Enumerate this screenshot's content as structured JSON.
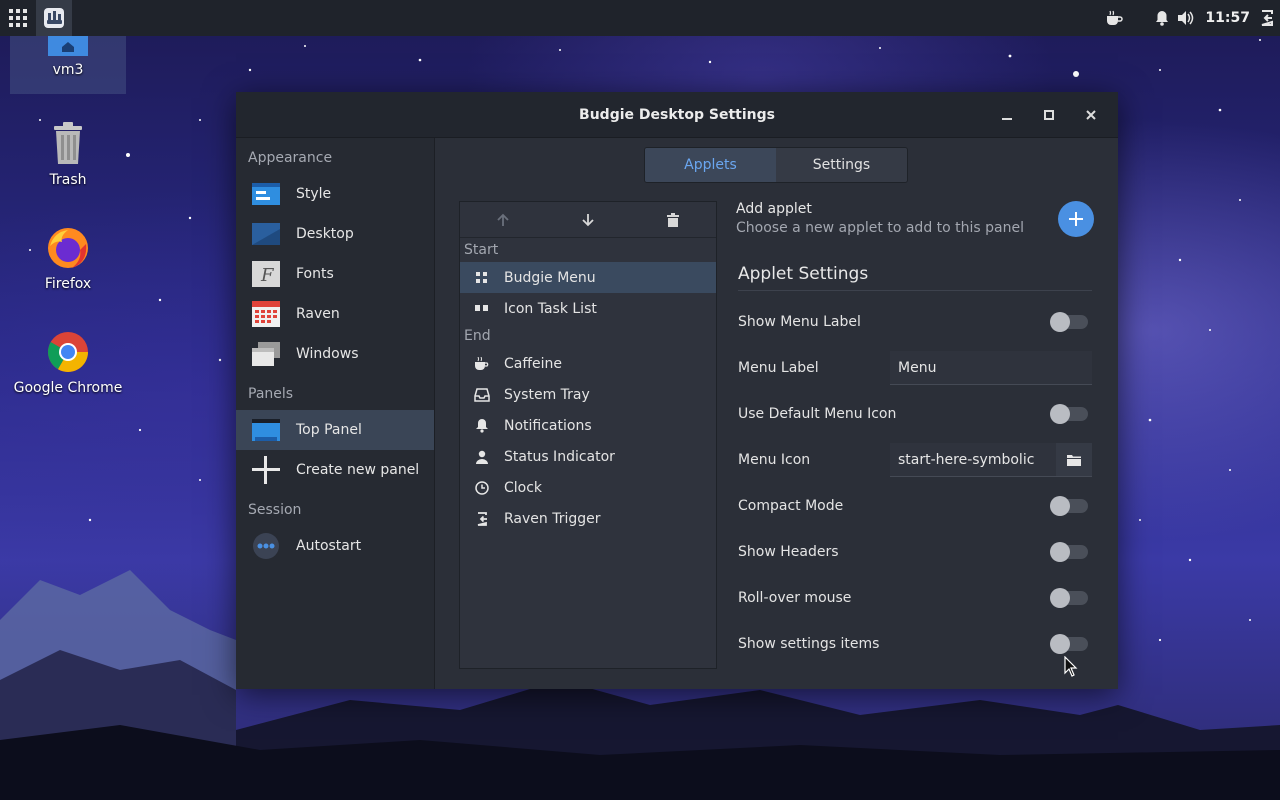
{
  "panel": {
    "clock": "11:57"
  },
  "desktop": {
    "icons": [
      {
        "label": "vm3"
      },
      {
        "label": "Trash"
      },
      {
        "label": "Firefox"
      },
      {
        "label": "Google Chrome"
      }
    ]
  },
  "window": {
    "title": "Budgie Desktop Settings"
  },
  "sidebar": {
    "sections": [
      {
        "title": "Appearance",
        "items": [
          {
            "label": "Style",
            "icon": "style-icon"
          },
          {
            "label": "Desktop",
            "icon": "desktop-icon"
          },
          {
            "label": "Fonts",
            "icon": "fonts-icon"
          },
          {
            "label": "Raven",
            "icon": "calendar-icon"
          },
          {
            "label": "Windows",
            "icon": "windows-icon"
          }
        ]
      },
      {
        "title": "Panels",
        "items": [
          {
            "label": "Top Panel",
            "icon": "panel-icon",
            "active": true
          },
          {
            "label": "Create new panel",
            "icon": "plus-icon"
          }
        ]
      },
      {
        "title": "Session",
        "items": [
          {
            "label": "Autostart",
            "icon": "autostart-icon"
          }
        ]
      }
    ]
  },
  "tabs": {
    "applets": "Applets",
    "settings": "Settings",
    "active": "applets"
  },
  "applet_list": {
    "start_label": "Start",
    "end_label": "End",
    "start_items": [
      {
        "label": "Budgie Menu",
        "icon": "grid-icon",
        "active": true
      },
      {
        "label": "Icon Task List",
        "icon": "tasklist-icon"
      }
    ],
    "end_items": [
      {
        "label": "Caffeine",
        "icon": "coffee-icon"
      },
      {
        "label": "System Tray",
        "icon": "tray-icon"
      },
      {
        "label": "Notifications",
        "icon": "bell-icon"
      },
      {
        "label": "Status Indicator",
        "icon": "user-icon"
      },
      {
        "label": "Clock",
        "icon": "clock-icon"
      },
      {
        "label": "Raven Trigger",
        "icon": "raven-trigger-icon"
      }
    ]
  },
  "add_applet": {
    "title": "Add applet",
    "subtitle": "Choose a new applet to add to this panel"
  },
  "applet_settings": {
    "title": "Applet Settings",
    "show_menu_label": "Show Menu Label",
    "menu_label": "Menu Label",
    "menu_label_value": "Menu",
    "use_default_menu_icon": "Use Default Menu Icon",
    "menu_icon": "Menu Icon",
    "menu_icon_value": "start-here-symbolic",
    "compact_mode": "Compact Mode",
    "show_headers": "Show Headers",
    "roll_over_mouse": "Roll-over mouse",
    "show_settings_items": "Show settings items"
  }
}
